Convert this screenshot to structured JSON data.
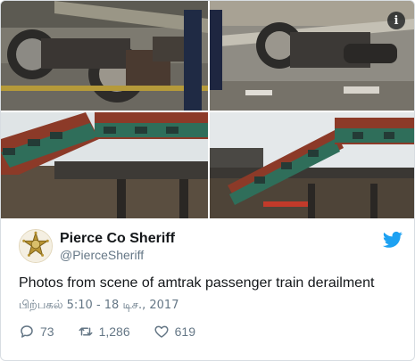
{
  "tweet": {
    "author_name": "Pierce Co Sheriff",
    "author_handle": "@PierceSheriff",
    "text": "Photos from scene of amtrak passenger train derailment",
    "timestamp": "பிற்பகல் 5:10 - 18 டிச., 2017",
    "replies": "73",
    "retweets": "1,286",
    "likes": "619"
  },
  "media": {
    "info_glyph": "i"
  },
  "icons": {
    "avatar": "sheriff-star-badge-icon",
    "brand": "twitter-bird-icon",
    "reply": "reply-bubble-icon",
    "retweet": "retweet-icon",
    "like": "heart-icon",
    "info": "info-icon"
  },
  "colors": {
    "brand_blue": "#1da1f2",
    "text_primary": "#14171a",
    "text_secondary": "#657786"
  }
}
